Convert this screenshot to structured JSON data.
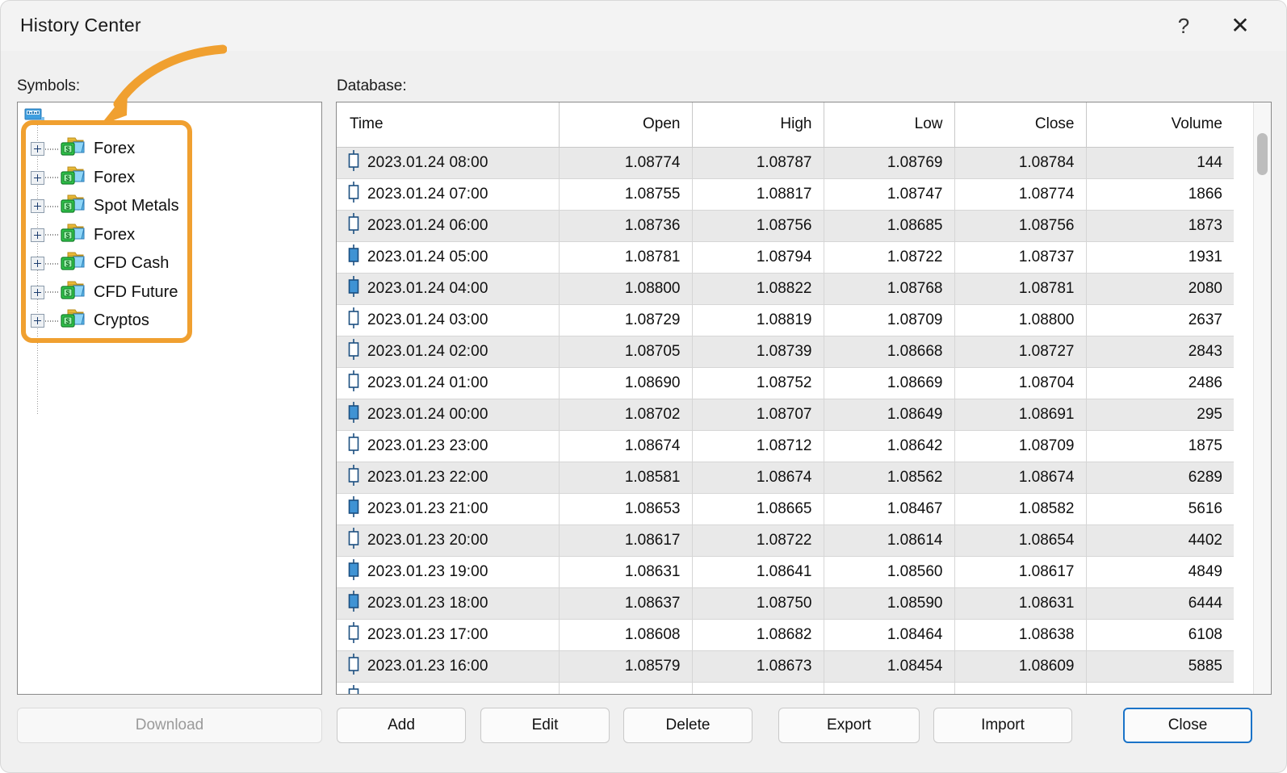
{
  "window": {
    "title": "History Center",
    "help_glyph": "?",
    "close_glyph": "✕"
  },
  "symbols": {
    "label": "Symbols:",
    "root_icon": "server-root-icon",
    "items": [
      {
        "label": "Forex",
        "icon": "money-folder-icon",
        "expander": "plus-expander"
      },
      {
        "label": "Forex",
        "icon": "money-folder-icon",
        "expander": "plus-expander"
      },
      {
        "label": "Spot Metals",
        "icon": "money-folder-icon",
        "expander": "plus-expander"
      },
      {
        "label": "Forex",
        "icon": "money-folder-icon",
        "expander": "plus-expander"
      },
      {
        "label": "CFD Cash",
        "icon": "money-folder-icon",
        "expander": "plus-expander"
      },
      {
        "label": "CFD Future",
        "icon": "money-folder-icon",
        "expander": "plus-expander"
      },
      {
        "label": "Cryptos",
        "icon": "money-folder-icon",
        "expander": "plus-expander"
      }
    ]
  },
  "annotation": {
    "highlight_color": "#F0A030",
    "arrow_color": "#F0A030",
    "target": "symbols-tree-items"
  },
  "database": {
    "label": "Database:",
    "columns": [
      "Time",
      "Open",
      "High",
      "Low",
      "Close",
      "Volume"
    ],
    "rows": [
      {
        "time": "2023.01.24 08:00",
        "open": "1.08774",
        "high": "1.08787",
        "low": "1.08769",
        "close": "1.08784",
        "volume": "144",
        "candle": "hollow"
      },
      {
        "time": "2023.01.24 07:00",
        "open": "1.08755",
        "high": "1.08817",
        "low": "1.08747",
        "close": "1.08774",
        "volume": "1866",
        "candle": "hollow"
      },
      {
        "time": "2023.01.24 06:00",
        "open": "1.08736",
        "high": "1.08756",
        "low": "1.08685",
        "close": "1.08756",
        "volume": "1873",
        "candle": "hollow"
      },
      {
        "time": "2023.01.24 05:00",
        "open": "1.08781",
        "high": "1.08794",
        "low": "1.08722",
        "close": "1.08737",
        "volume": "1931",
        "candle": "filled"
      },
      {
        "time": "2023.01.24 04:00",
        "open": "1.08800",
        "high": "1.08822",
        "low": "1.08768",
        "close": "1.08781",
        "volume": "2080",
        "candle": "filled"
      },
      {
        "time": "2023.01.24 03:00",
        "open": "1.08729",
        "high": "1.08819",
        "low": "1.08709",
        "close": "1.08800",
        "volume": "2637",
        "candle": "hollow"
      },
      {
        "time": "2023.01.24 02:00",
        "open": "1.08705",
        "high": "1.08739",
        "low": "1.08668",
        "close": "1.08727",
        "volume": "2843",
        "candle": "hollow"
      },
      {
        "time": "2023.01.24 01:00",
        "open": "1.08690",
        "high": "1.08752",
        "low": "1.08669",
        "close": "1.08704",
        "volume": "2486",
        "candle": "hollow"
      },
      {
        "time": "2023.01.24 00:00",
        "open": "1.08702",
        "high": "1.08707",
        "low": "1.08649",
        "close": "1.08691",
        "volume": "295",
        "candle": "filled"
      },
      {
        "time": "2023.01.23 23:00",
        "open": "1.08674",
        "high": "1.08712",
        "low": "1.08642",
        "close": "1.08709",
        "volume": "1875",
        "candle": "hollow"
      },
      {
        "time": "2023.01.23 22:00",
        "open": "1.08581",
        "high": "1.08674",
        "low": "1.08562",
        "close": "1.08674",
        "volume": "6289",
        "candle": "hollow"
      },
      {
        "time": "2023.01.23 21:00",
        "open": "1.08653",
        "high": "1.08665",
        "low": "1.08467",
        "close": "1.08582",
        "volume": "5616",
        "candle": "filled"
      },
      {
        "time": "2023.01.23 20:00",
        "open": "1.08617",
        "high": "1.08722",
        "low": "1.08614",
        "close": "1.08654",
        "volume": "4402",
        "candle": "hollow"
      },
      {
        "time": "2023.01.23 19:00",
        "open": "1.08631",
        "high": "1.08641",
        "low": "1.08560",
        "close": "1.08617",
        "volume": "4849",
        "candle": "filled"
      },
      {
        "time": "2023.01.23 18:00",
        "open": "1.08637",
        "high": "1.08750",
        "low": "1.08590",
        "close": "1.08631",
        "volume": "6444",
        "candle": "filled"
      },
      {
        "time": "2023.01.23 17:00",
        "open": "1.08608",
        "high": "1.08682",
        "low": "1.08464",
        "close": "1.08638",
        "volume": "6108",
        "candle": "hollow"
      },
      {
        "time": "2023.01.23 16:00",
        "open": "1.08579",
        "high": "1.08673",
        "low": "1.08454",
        "close": "1.08609",
        "volume": "5885",
        "candle": "hollow"
      }
    ]
  },
  "buttons": {
    "download": "Download",
    "add": "Add",
    "edit": "Edit",
    "delete": "Delete",
    "export": "Export",
    "import": "Import",
    "close": "Close"
  }
}
